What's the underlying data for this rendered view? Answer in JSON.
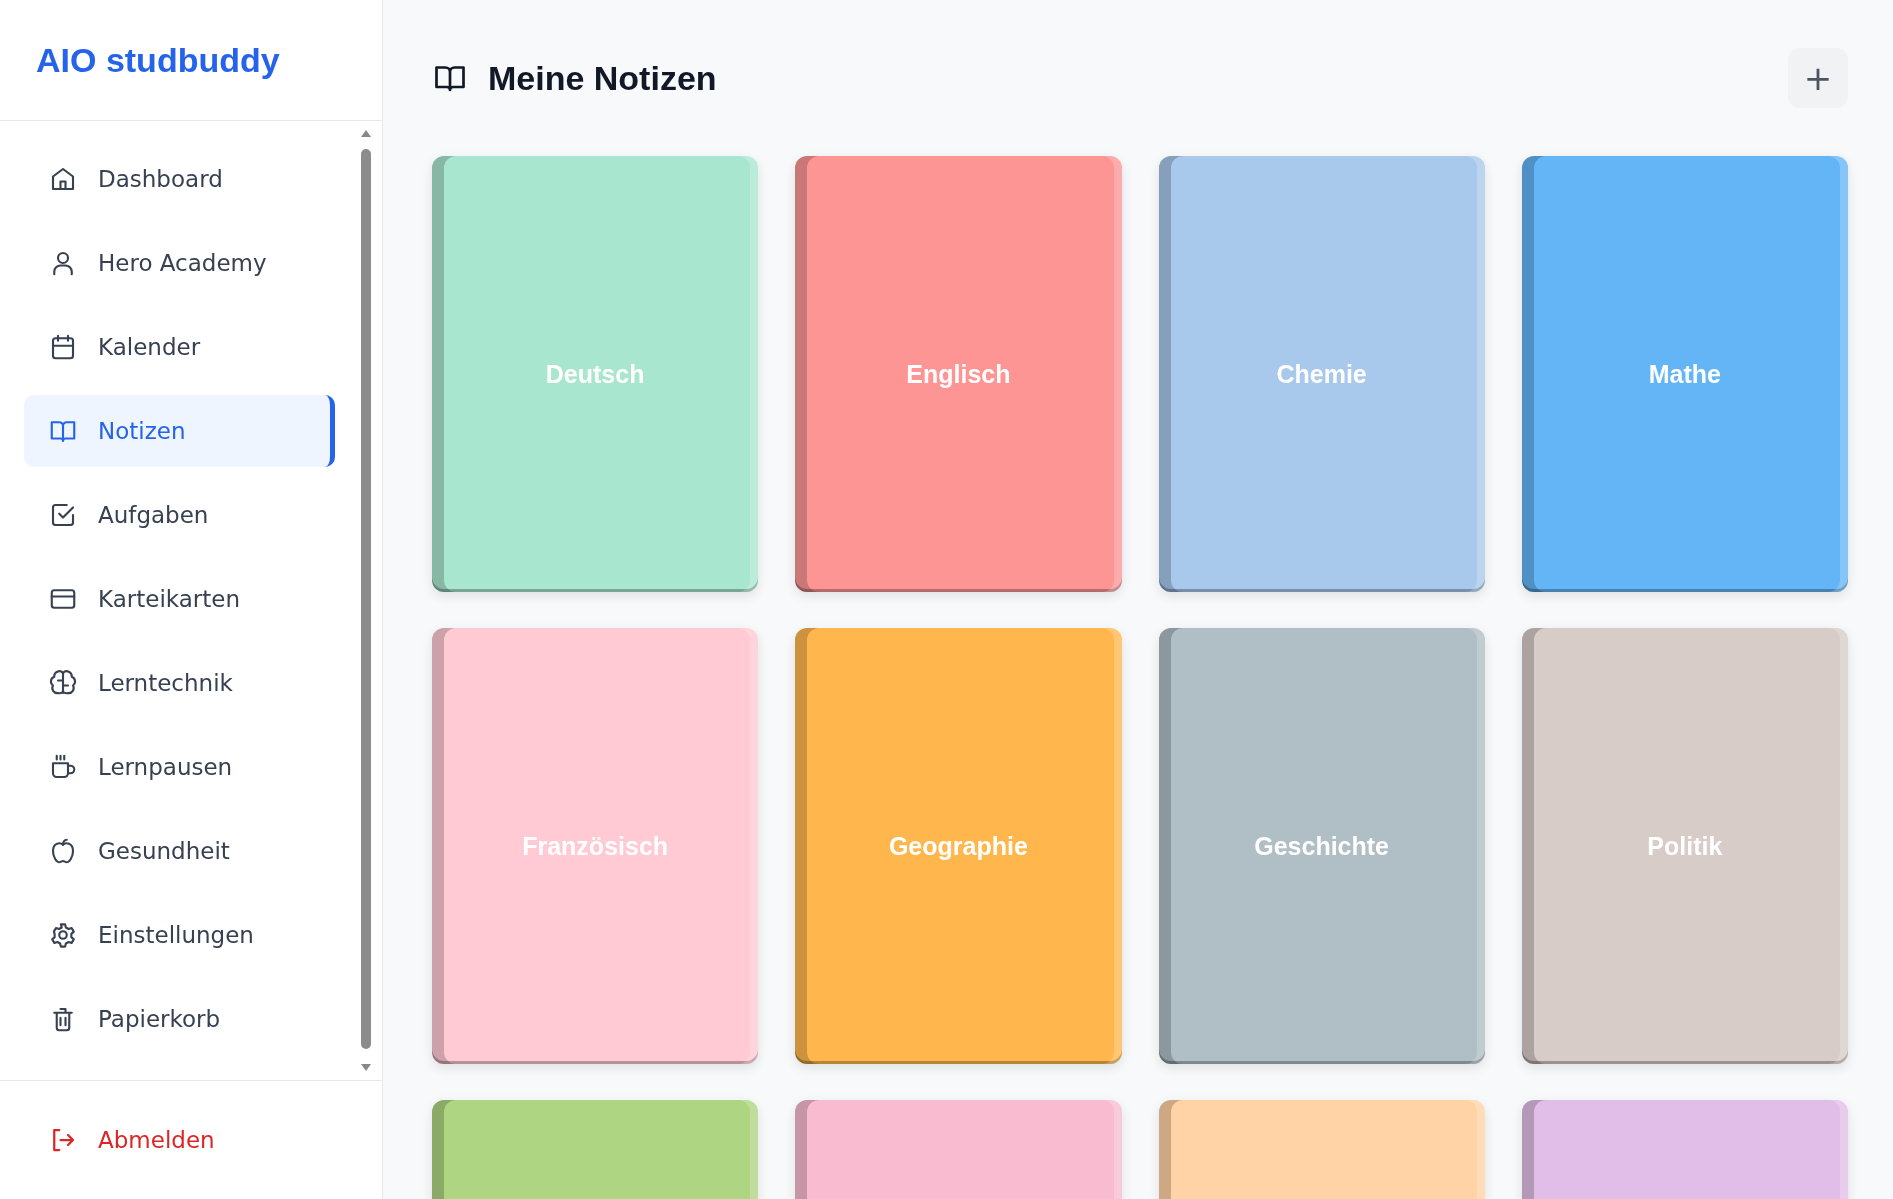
{
  "sidebar": {
    "logo": "AIO studbuddy",
    "items": [
      {
        "label": "Dashboard",
        "selected": false
      },
      {
        "label": "Hero Academy",
        "selected": false
      },
      {
        "label": "Kalender",
        "selected": false
      },
      {
        "label": "Notizen",
        "selected": true
      },
      {
        "label": "Aufgaben",
        "selected": false
      },
      {
        "label": "Karteikarten",
        "selected": false
      },
      {
        "label": "Lerntechnik",
        "selected": false
      },
      {
        "label": "Lernpausen",
        "selected": false
      },
      {
        "label": "Gesundheit",
        "selected": false
      },
      {
        "label": "Einstellungen",
        "selected": false
      },
      {
        "label": "Papierkorb",
        "selected": false
      }
    ],
    "logout": "Abmelden"
  },
  "header": {
    "title": "Meine Notizen",
    "add_button": "+"
  },
  "notebooks": [
    {
      "title": "Deutsch",
      "color": "#a8e6cf"
    },
    {
      "title": "Englisch",
      "color": "#fd9595"
    },
    {
      "title": "Chemie",
      "color": "#a8c8ec"
    },
    {
      "title": "Mathe",
      "color": "#64b5f6"
    },
    {
      "title": "Französisch",
      "color": "#ffcad4"
    },
    {
      "title": "Geographie",
      "color": "#ffb74d"
    },
    {
      "title": "Geschichte",
      "color": "#b0bec5"
    },
    {
      "title": "Politik",
      "color": "#d7ccc8"
    },
    {
      "color": "#aed581"
    },
    {
      "color": "#f8bbd0"
    },
    {
      "color": "#ffd3a5"
    },
    {
      "color": "#e1bee7"
    }
  ]
}
